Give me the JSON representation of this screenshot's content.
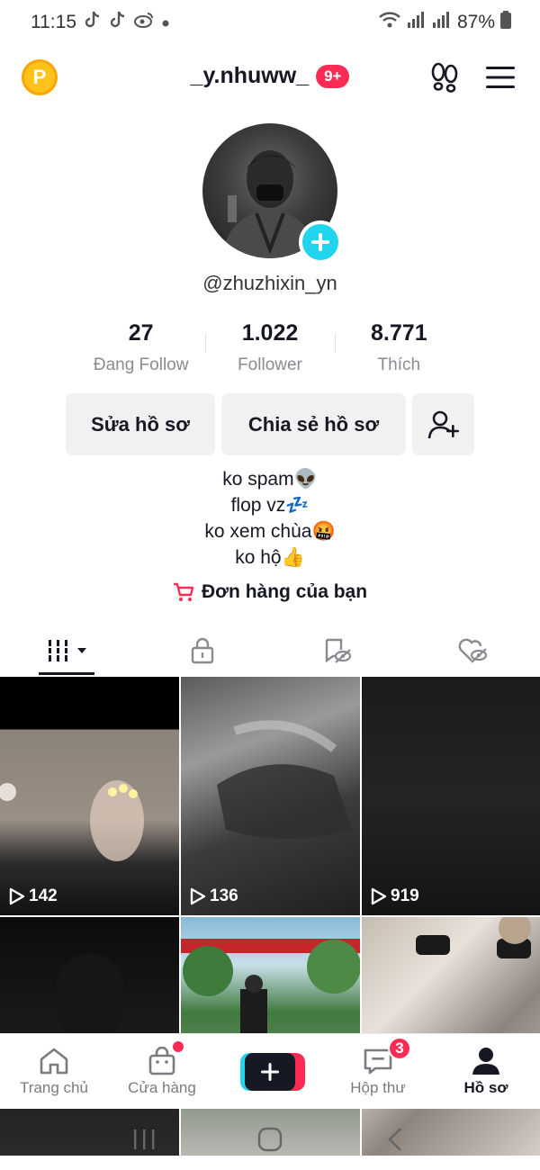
{
  "status_bar": {
    "time": "11:15",
    "battery": "87%"
  },
  "header": {
    "coin_label": "P",
    "username": "_y.nhuww_",
    "badge": "9+"
  },
  "profile": {
    "handle": "@zhuzhixin_yn",
    "stats": [
      {
        "value": "27",
        "label": "Đang Follow"
      },
      {
        "value": "1.022",
        "label": "Follower"
      },
      {
        "value": "8.771",
        "label": "Thích"
      }
    ]
  },
  "actions": {
    "edit": "Sửa hồ sơ",
    "share": "Chia sẻ hồ sơ"
  },
  "bio": [
    "ko spam👽",
    "flop vz💤",
    "ko xem chùa🤬",
    "ko hộ👍"
  ],
  "orders_label": "Đơn hàng của bạn",
  "tabs": [
    "videos-tab",
    "private-tab",
    "reposts-tab",
    "liked-tab"
  ],
  "grid": [
    {
      "views": "142"
    },
    {
      "views": "136"
    },
    {
      "views": "919"
    },
    {
      "views": ""
    },
    {
      "views": ""
    },
    {
      "views": ""
    }
  ],
  "bottom_nav": {
    "home": "Trang chủ",
    "shop": "Cửa hàng",
    "inbox": "Hộp thư",
    "inbox_count": "3",
    "profile": "Hồ sơ"
  },
  "colors": {
    "accent": "#fe2c55",
    "cyan": "#20d5ec",
    "text": "#161823"
  }
}
